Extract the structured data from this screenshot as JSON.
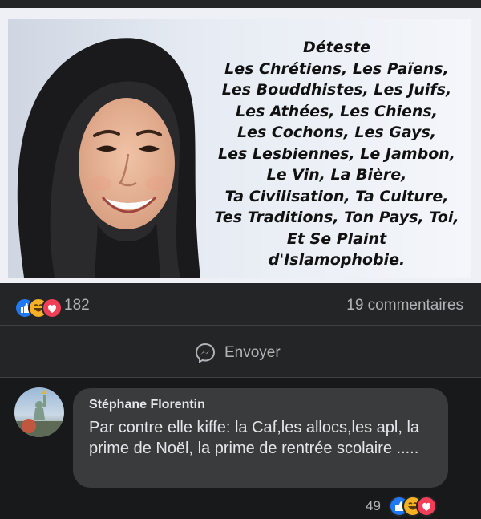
{
  "post": {
    "image_text_lines": [
      "Déteste",
      "Les Chrétiens, Les Païens,",
      "Les Bouddhistes, Les Juifs,",
      "Les Athées, Les Chiens,",
      "Les Cochons, Les Gays,",
      "Les Lesbiennes, Le Jambon,",
      "Le Vin, La Bière,",
      "Ta Civilisation, Ta Culture,",
      "Tes Traditions, Ton Pays, Toi,",
      "Et Se Plaint",
      "d'Islamophobie."
    ],
    "reaction_icons": [
      "like-icon",
      "haha-icon",
      "love-icon"
    ],
    "reaction_count": "182",
    "comments_count": "19 commentaires",
    "send_label": "Envoyer"
  },
  "comment": {
    "author": "Stéphane Florentin",
    "text": "Par contre elle kiffe: la Caf,les allocs,les apl,  la prime de Noël, la prime de rentrée scolaire .....",
    "reaction_count": "49",
    "reaction_icons": [
      "like-icon",
      "haha-icon",
      "love-icon"
    ]
  },
  "colors": {
    "background": "#18191a",
    "card": "#242526",
    "bubble": "#3a3b3c",
    "like": "#2078f4",
    "haha": "#f7b125",
    "love": "#f33e58"
  }
}
